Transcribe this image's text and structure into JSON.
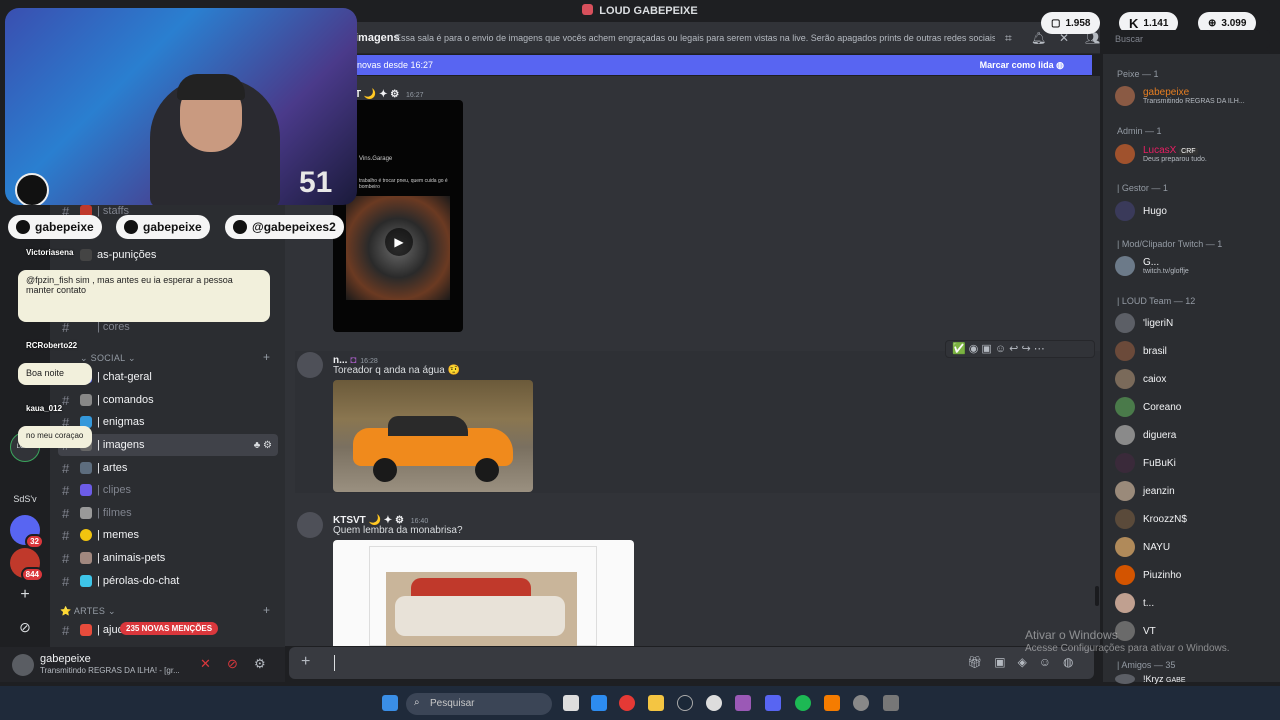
{
  "window": {
    "title": "LOUD GABEPEIXE"
  },
  "header": {
    "channel": "imagens",
    "topic": "Essa sala é para o envio de imagens que vocês achem engraçadas ou legais para serem vistas na live. Serão apagados prints de outras redes sociais c...",
    "search_placeholder": "Buscar"
  },
  "stats": [
    {
      "icon": "chat-bubble-icon",
      "value": "1.958"
    },
    {
      "icon": "kick-icon",
      "value": "1.141"
    },
    {
      "icon": "globe-icon",
      "value": "3.099"
    }
  ],
  "new_messages": {
    "label": "novas desde 16:27",
    "action": "Marcar como lida"
  },
  "servers": {
    "label_sds": "SdS'v",
    "badge_a": "32",
    "badge_b": "844"
  },
  "channels": {
    "items": [
      {
        "name": "| staffs",
        "muted": true
      },
      {
        "name": "as-punições",
        "muted": false
      },
      {
        "name": "| cores",
        "muted": true
      },
      {
        "name": "| chat-geral",
        "muted": false
      },
      {
        "name": "| comandos",
        "muted": false
      },
      {
        "name": "| enigmas",
        "muted": false
      },
      {
        "name": "| imagens",
        "muted": false
      },
      {
        "name": "| artes",
        "muted": false
      },
      {
        "name": "| clipes",
        "muted": true
      },
      {
        "name": "| filmes",
        "muted": true
      },
      {
        "name": "| memes",
        "muted": false
      },
      {
        "name": "| animais-pets",
        "muted": false
      },
      {
        "name": "| pérolas-do-chat",
        "muted": false
      },
      {
        "name": "| ajud",
        "muted": false
      }
    ],
    "category_social": "SOCIAL",
    "category_artes": "ARTES",
    "mentions_badge": "235 NOVAS MENÇÕES"
  },
  "user": {
    "name": "gabepeixe",
    "status": "Transmitindo REGRAS DA ILHA! - [gr..."
  },
  "messages": [
    {
      "author": "T 🌙 ",
      "time": "16:27",
      "text": "",
      "video_caption": "Vins.Garage",
      "video_text": "trabalho é trocar pneu, quem cuida go é bombeiro"
    },
    {
      "author": "n...",
      "time": "16:28",
      "text": "Toreador q anda na água 🤨"
    },
    {
      "author": "KTSVT 🌙 ",
      "time": "16:40",
      "text": "Quem lembra da monabrisa?"
    }
  ],
  "members": {
    "groups": [
      {
        "role": "Peixe — 1",
        "list": [
          {
            "name": "gabepeixe",
            "sub": "Transmitindo REGRAS DA ILH...",
            "color": "#e67e22"
          }
        ]
      },
      {
        "role": "Admin — 1",
        "list": [
          {
            "name": "LucasX",
            "sub": "Deus preparou tudo.",
            "tag": "CRF",
            "color": "#e91e63"
          }
        ]
      },
      {
        "role": "| Gestor — 1",
        "list": [
          {
            "name": "Hugo",
            "sub": "",
            "color": "#f2f3f5"
          }
        ]
      },
      {
        "role": "| Mod/Clipador Twitch — 1",
        "list": [
          {
            "name": "G...",
            "sub": "twitch.tv/gloffje",
            "color": "#f2f3f5"
          }
        ]
      },
      {
        "role": "| LOUD Team — 12",
        "list": [
          {
            "name": "'ligeriN"
          },
          {
            "name": "brasil"
          },
          {
            "name": "caiox"
          },
          {
            "name": "Coreano"
          },
          {
            "name": "diguera"
          },
          {
            "name": "FuBuKi"
          },
          {
            "name": "jeanzin"
          },
          {
            "name": "KroozzN$"
          },
          {
            "name": "NAYU"
          },
          {
            "name": "Piuzinho"
          },
          {
            "name": "t..."
          },
          {
            "name": "VT"
          }
        ]
      },
      {
        "role": "| Amigos — 35",
        "list": [
          {
            "name": "!Kryz",
            "tag": "GABE"
          }
        ]
      }
    ]
  },
  "overlay": {
    "socials": [
      "gabepeixe",
      "gabepeixe",
      "@gabepeixes2"
    ],
    "viewer_number": "51",
    "chat": [
      {
        "user": "Victoriasena",
        "text": ""
      },
      {
        "user": "",
        "text": "@fpzin_fish sim , mas antes eu ia esperar a pessoa manter contato"
      },
      {
        "user": "RCRoberto22",
        "text": ""
      },
      {
        "user": "",
        "text": "Boa noite"
      },
      {
        "user": "kaua_012",
        "text": ""
      },
      {
        "user": "",
        "text": "no meu coraçao"
      }
    ]
  },
  "watermark": {
    "line1": "Ativar o Windows",
    "line2": "Acesse Configurações para ativar o Windows."
  },
  "taskbar": {
    "search": "Pesquisar"
  }
}
